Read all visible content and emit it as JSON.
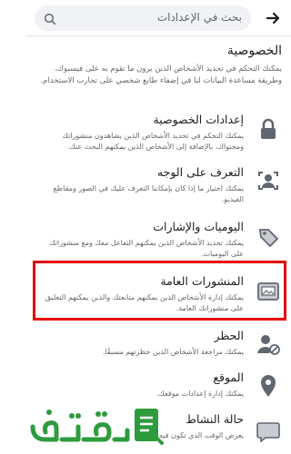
{
  "search": {
    "placeholder": "بحث في الإعدادات"
  },
  "section": {
    "title": "الخصوصية",
    "description": "يمكنك التحكم في تحديد الأشخاص الذين يرون ما تقوم به على فيسبوك، وطريقة مساعدة البيانات لنا في إضفاء طابع شخصي على تجارب الاستخدام."
  },
  "items": [
    {
      "title": "إعدادات الخصوصية",
      "desc": "يمكنك التحكم في تحديد الأشخاص الذين يشاهدون منشوراتك ومحتواك، بالإضافة إلى الأشخاص الذين يمكنهم البحث عنك.",
      "icon": "lock-icon"
    },
    {
      "title": "التعرف على الوجه",
      "desc": "يمكنك اختيار ما إذا كان بإمكاننا التعرف عليك في الصور ومقاطع الفيديو.",
      "icon": "face-recognition-icon"
    },
    {
      "title": "اليوميات والإشارات",
      "desc": "يمكنك تحديد الأشخاص الذين يمكنهم التفاعل معك ومع منشوراتك على اليوميات.",
      "icon": "tag-icon"
    },
    {
      "title": "المنشورات العامة",
      "desc": "يمكنك إدارة الأشخاص الذين يمكنهم متابعتك والذين يمكنهم التعليق على منشوراتك العامة.",
      "icon": "public-posts-icon"
    },
    {
      "title": "الحظر",
      "desc": "يمكنك مراجعة الأشخاص الذين حظرتهم مسبقًا.",
      "icon": "block-user-icon"
    },
    {
      "title": "الموقع",
      "desc": "يمكنك إدارة إعدادات موقعك.",
      "icon": "location-icon"
    },
    {
      "title": "حالة النشاط",
      "desc": "يعرض الوقت الذي تكون فيه",
      "icon": "activity-status-icon"
    }
  ],
  "watermark": {
    "text": "فكرة"
  },
  "colors": {
    "highlight": "#e60000",
    "watermark_green": "#2e9b3c",
    "icon_bg": "#606770"
  }
}
